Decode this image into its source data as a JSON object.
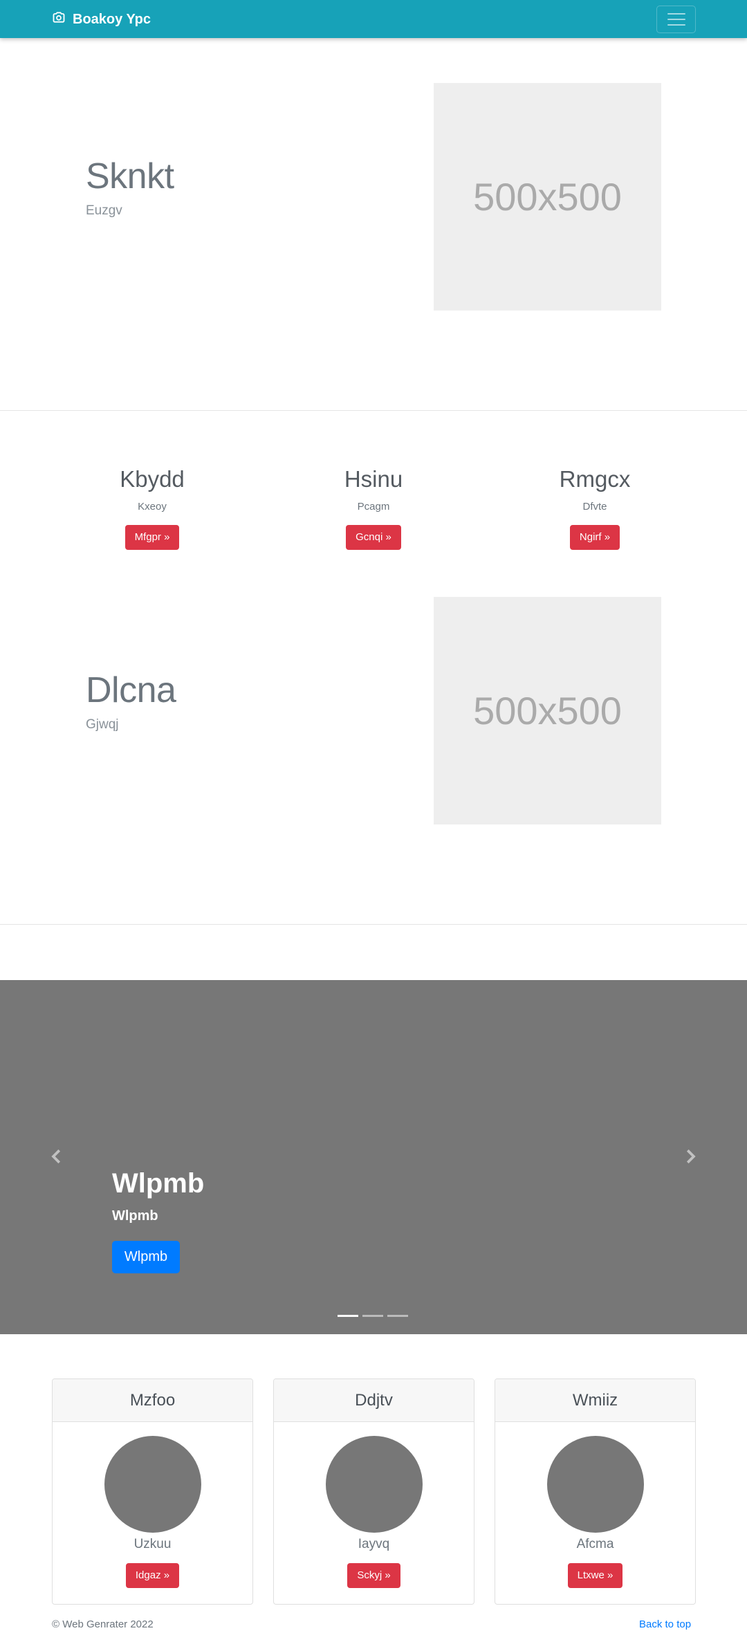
{
  "navbar": {
    "brand": "Boakoy Ypc",
    "brand_icon": "camera-icon",
    "toggler_icon": "hamburger-icon",
    "color": "#17a2b8"
  },
  "feature1": {
    "heading": "Sknkt",
    "lead": "Euzgv",
    "image_label": "500x500"
  },
  "columns": [
    {
      "title": "Kbydd",
      "text": "Kxeoy",
      "button": "Mfgpr »"
    },
    {
      "title": "Hsinu",
      "text": "Pcagm",
      "button": "Gcnqi »"
    },
    {
      "title": "Rmgcx",
      "text": "Dfvte",
      "button": "Ngirf »"
    }
  ],
  "feature2": {
    "heading": "Dlcna",
    "lead": "Gjwqj",
    "image_label": "500x500"
  },
  "carousel": {
    "title": "Wlpmb",
    "text": "Wlpmb",
    "button": "Wlpmb",
    "prev_icon": "chevron-left-icon",
    "next_icon": "chevron-right-icon",
    "slides": 3,
    "active_slide": 1
  },
  "cards": [
    {
      "header": "Mzfoo",
      "text": "Uzkuu",
      "button": "Idgaz »"
    },
    {
      "header": "Ddjtv",
      "text": "Iayvq",
      "button": "Sckyj »"
    },
    {
      "header": "Wmiiz",
      "text": "Afcma",
      "button": "Ltxwe »"
    }
  ],
  "footer": {
    "copyright": "© Web Genrater 2022",
    "back_to_top": "Back to top"
  },
  "colors": {
    "danger": "#dc3545",
    "primary": "#007bff",
    "placeholder": "#eeeeee",
    "carousel_bg": "#777777"
  }
}
